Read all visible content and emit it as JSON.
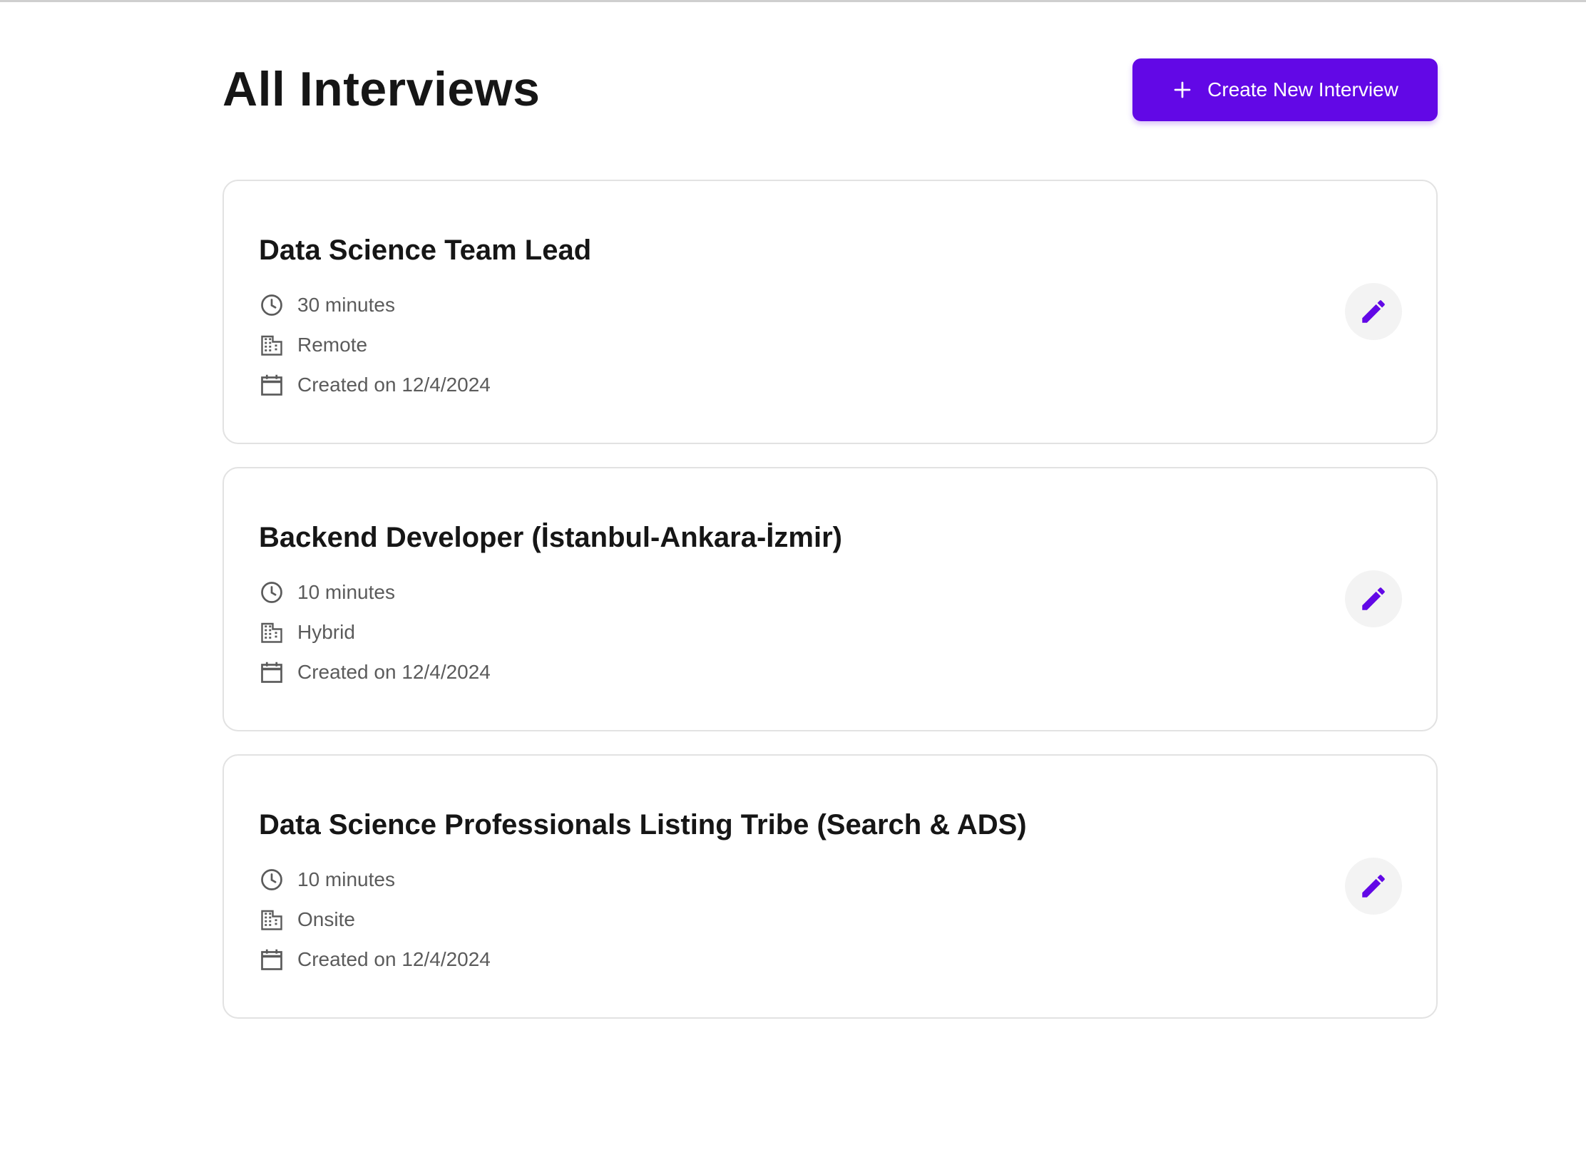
{
  "page": {
    "title": "All Interviews",
    "create_button_label": "Create New Interview"
  },
  "colors": {
    "accent": "#6208e6",
    "text_primary": "#161616",
    "text_secondary": "#5b5b5b",
    "card_border": "#e2e2e2",
    "edit_button_bg": "#f3f3f3"
  },
  "icons": {
    "create": "plus-icon",
    "duration": "clock-icon",
    "location": "building-icon",
    "created": "calendar-icon",
    "edit": "pencil-icon"
  },
  "interviews": [
    {
      "title": "Data Science Team Lead",
      "duration": "30 minutes",
      "location_type": "Remote",
      "created": "Created on 12/4/2024"
    },
    {
      "title": "Backend Developer (İstanbul-Ankara-İzmir)",
      "duration": "10 minutes",
      "location_type": "Hybrid",
      "created": "Created on 12/4/2024"
    },
    {
      "title": "Data Science Professionals Listing Tribe (Search & ADS)",
      "duration": "10 minutes",
      "location_type": "Onsite",
      "created": "Created on 12/4/2024"
    }
  ]
}
